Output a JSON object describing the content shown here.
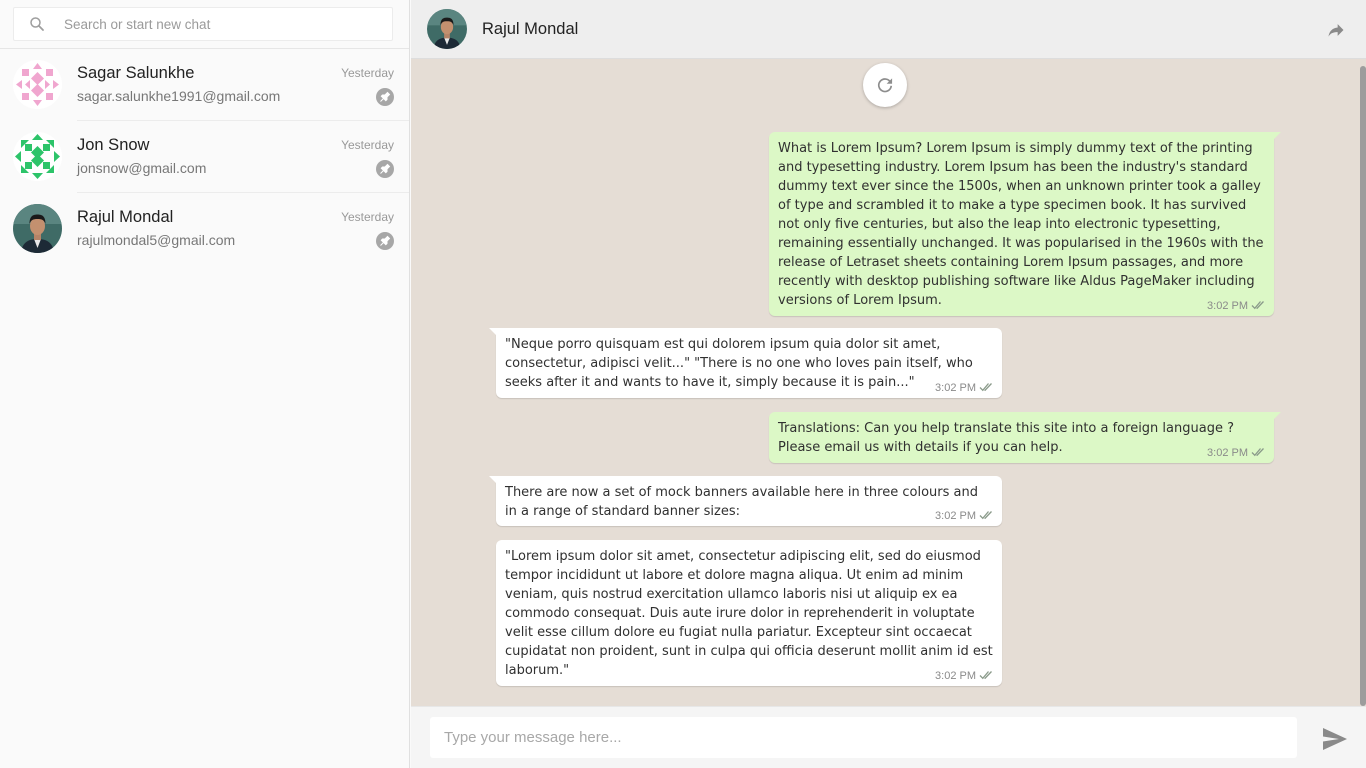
{
  "search": {
    "placeholder": "Search or start new chat"
  },
  "contacts": [
    {
      "name": "Sagar Salunkhe",
      "email": "sagar.salunkhe1991@gmail.com",
      "time": "Yesterday",
      "avatar": "identicon-pink"
    },
    {
      "name": "Jon Snow",
      "email": "jonsnow@gmail.com",
      "time": "Yesterday",
      "avatar": "identicon-green"
    },
    {
      "name": "Rajul Mondal",
      "email": "rajulmondal5@gmail.com",
      "time": "Yesterday",
      "avatar": "profile-photo"
    }
  ],
  "header": {
    "title": "Rajul Mondal",
    "share_icon": "share-icon"
  },
  "messages": [
    {
      "direction": "out",
      "text": "What is Lorem Ipsum? Lorem Ipsum is simply dummy text of the printing and typesetting industry. Lorem Ipsum has been the industry's standard dummy text ever since the 1500s, when an unknown printer took a galley of type and scrambled it to make a type specimen book. It has survived not only five centuries, but also the leap into electronic typesetting, remaining essentially unchanged. It was popularised in the 1960s with the release of Letraset sheets containing Lorem Ipsum passages, and more recently with desktop publishing software like Aldus PageMaker including versions of Lorem Ipsum.",
      "time": "3:02 PM"
    },
    {
      "direction": "in",
      "text": "\"Neque porro quisquam est qui dolorem ipsum quia dolor sit amet, consectetur, adipisci velit...\" \"There is no one who loves pain itself, who seeks after it and wants to have it, simply because it is pain...\"",
      "time": "3:02 PM"
    },
    {
      "direction": "out",
      "text": "Translations: Can you help translate this site into a foreign language ? Please email us with details if you can help.",
      "time": "3:02 PM"
    },
    {
      "direction": "in",
      "text": "There are now a set of mock banners available here in three colours and in a range of standard banner sizes:",
      "time": "3:02 PM"
    },
    {
      "direction": "in",
      "text": "\"Lorem ipsum dolor sit amet, consectetur adipiscing elit, sed do eiusmod tempor incididunt ut labore et dolore magna aliqua. Ut enim ad minim veniam, quis nostrud exercitation ullamco laboris nisi ut aliquip ex ea commodo consequat. Duis aute irure dolor in reprehenderit in voluptate velit esse cillum dolore eu fugiat nulla pariatur. Excepteur sint occaecat cupidatat non proident, sunt in culpa qui officia deserunt mollit anim id est laborum.\"",
      "time": "3:02 PM"
    }
  ],
  "composer": {
    "placeholder": "Type your message here..."
  },
  "colors": {
    "outgoing": "#dcf8c6",
    "incoming": "#ffffff",
    "chat_bg": "#e5ddd5",
    "header_bg": "#eeeeee"
  }
}
